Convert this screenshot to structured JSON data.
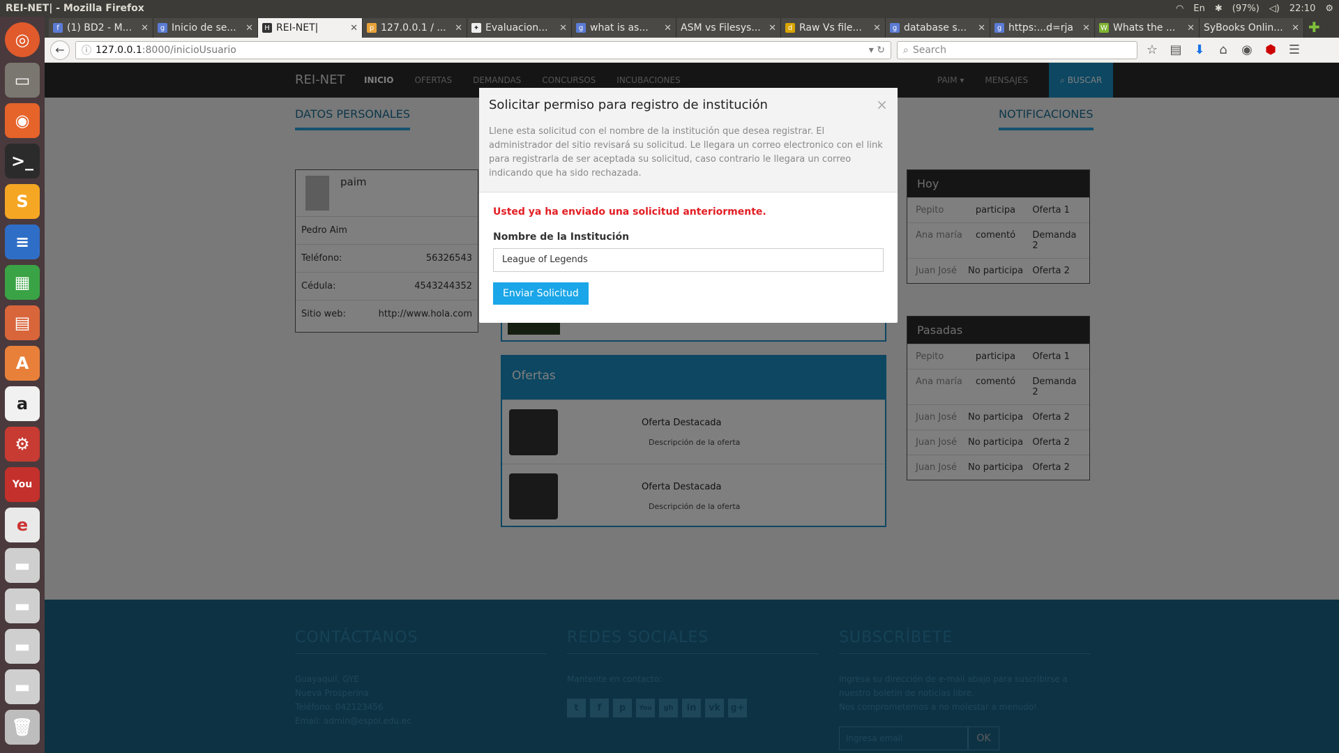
{
  "os": {
    "window_title": "REI-NET| - Mozilla Firefox",
    "battery": "(97%)",
    "time": "22:10",
    "kbd": "En"
  },
  "tabs": [
    "(1) BD2 - M...",
    "Inicio de se...",
    "REI-NET|",
    "127.0.0.1 / ...",
    "Evaluacion...",
    "what is as...",
    "ASM vs Filesys...",
    "Raw Vs file...",
    "database s...",
    "https:...d=rja",
    "Whats the ...",
    "SyBooks Onlin..."
  ],
  "url": {
    "host": "127.0.0.1",
    "path": ":8000/inicioUsuario"
  },
  "search_placeholder": "Search",
  "site": {
    "brand": "REI-NET",
    "nav": [
      "INICIO",
      "OFERTAS",
      "DEMANDAS",
      "CONCURSOS",
      "INCUBACIONES"
    ],
    "user": "PAIM",
    "mensajes": "MENSAJES",
    "buscar": "BUSCAR"
  },
  "tabs_page": {
    "left": "DATOS PERSONALES",
    "right": "NOTIFICACIONES"
  },
  "profile": {
    "username": "paim",
    "name": "Pedro Aim",
    "rows": [
      {
        "k": "Teléfono:",
        "v": "56326543"
      },
      {
        "k": "Cédula:",
        "v": "4543244352"
      },
      {
        "k": "Sitio web:",
        "v": "http://www.hola.com"
      }
    ]
  },
  "ofertas": {
    "title": "Ofertas",
    "items": [
      {
        "t": "Oferta Destacada",
        "d": "Descripción de la oferta"
      },
      {
        "t": "Oferta Destacada",
        "d": "Descripción de la oferta"
      }
    ]
  },
  "notif": {
    "hoy": {
      "title": "Hoy",
      "rows": [
        [
          "Pepito",
          "participa",
          "Oferta 1"
        ],
        [
          "Ana maría",
          "comentó",
          "Demanda 2"
        ],
        [
          "Juan José",
          "No participa",
          "Oferta 2"
        ]
      ]
    },
    "pasadas": {
      "title": "Pasadas",
      "rows": [
        [
          "Pepito",
          "participa",
          "Oferta 1"
        ],
        [
          "Ana maría",
          "comentó",
          "Demanda 2"
        ],
        [
          "Juan José",
          "No participa",
          "Oferta 2"
        ],
        [
          "Juan José",
          "No participa",
          "Oferta 2"
        ],
        [
          "Juan José",
          "No participa",
          "Oferta 2"
        ]
      ]
    }
  },
  "footer": {
    "contact_h": "CONTÁCTANOS",
    "contact_lines": [
      "Guayaquil, GYE",
      "Nueva Prosperina",
      "Teléfono: 042123456",
      "Email: admin@espol.edu.ec"
    ],
    "social_h": "REDES SOCIALES",
    "social_p": "Mantente en contacto:",
    "social_icons": [
      "t",
      "f",
      "p",
      "You",
      "gh",
      "in",
      "vk",
      "g+"
    ],
    "sub_h": "SUBSCRÍBETE",
    "sub_lines": [
      "Ingresa su dirección de e-mail abajo para suscribirse a",
      "nuestro boletin de noticias libre.",
      "Nos comprometemos a no molestar a menudo!"
    ],
    "email_placeholder": "Ingresa email",
    "ok": "OK"
  },
  "modal": {
    "title": "Solicitar permiso para registro de institución",
    "desc": "Llene esta solicitud con el nombre de la institución que desea registrar. El administrador del sitio revisará su solicitud. Le llegara un correo electronico con el link para registrarla de ser aceptada su solicitud, caso contrario le llegara un correo indicando que ha sido rechazada.",
    "error": "Usted ya ha enviado una solicitud anteriormente.",
    "label": "Nombre de la Institución",
    "value": "League of Legends",
    "button": "Enviar Solicitud",
    "close": "×"
  }
}
